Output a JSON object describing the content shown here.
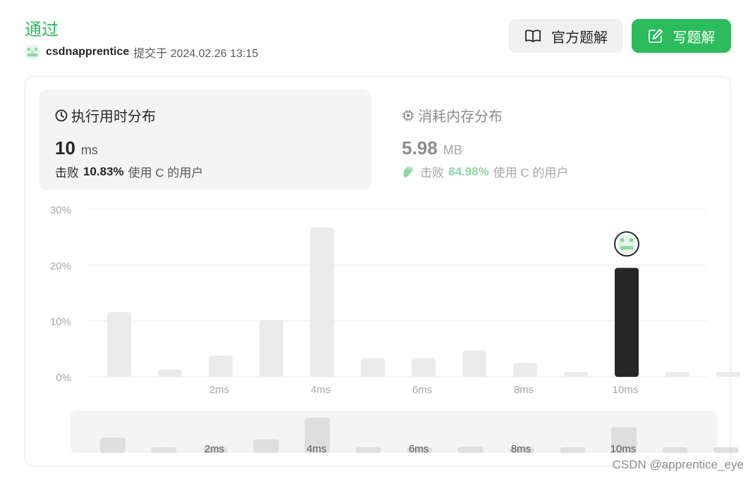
{
  "header": {
    "status": "通过",
    "username": "csdnapprentice",
    "submitted_text": "提交于 2024.02.26 13:15",
    "official_solution_label": "官方题解",
    "write_solution_label": "写题解"
  },
  "runtime": {
    "title": "执行用时分布",
    "value": "10",
    "unit": "ms",
    "beat_prefix": "击败",
    "beat_percent": "10.83%",
    "beat_suffix": "使用 C 的用户"
  },
  "memory": {
    "title": "消耗内存分布",
    "value": "5.98",
    "unit": "MB",
    "beat_prefix": "击败",
    "beat_percent": "84.98%",
    "beat_suffix": "使用 C 的用户"
  },
  "colors": {
    "accent": "#2cbb5d",
    "bar": "#ebebeb",
    "bar_selected": "#262626",
    "grid": "#e8e8e8",
    "axis_text": "#a6a6a6"
  },
  "chart_data": {
    "type": "bar",
    "y_tick_labels": [
      "0%",
      "10%",
      "20%",
      "30%"
    ],
    "ylim": [
      0,
      30
    ],
    "x_tick_labels": [
      "2ms",
      "4ms",
      "6ms",
      "8ms",
      "10ms"
    ],
    "x": [
      0,
      1,
      2,
      3,
      4,
      5,
      6,
      7,
      8,
      9,
      10,
      11,
      12
    ],
    "values": [
      11.6,
      1.3,
      3.8,
      10.2,
      26.7,
      3.4,
      3.4,
      4.7,
      2.5,
      0.9,
      19.5,
      0.9,
      0.9
    ],
    "selected_x": 10,
    "grid": true,
    "navigator_tick_labels": [
      "2ms",
      "4ms",
      "6ms",
      "8ms",
      "10ms"
    ]
  },
  "watermark": "CSDN @apprentice_eye"
}
